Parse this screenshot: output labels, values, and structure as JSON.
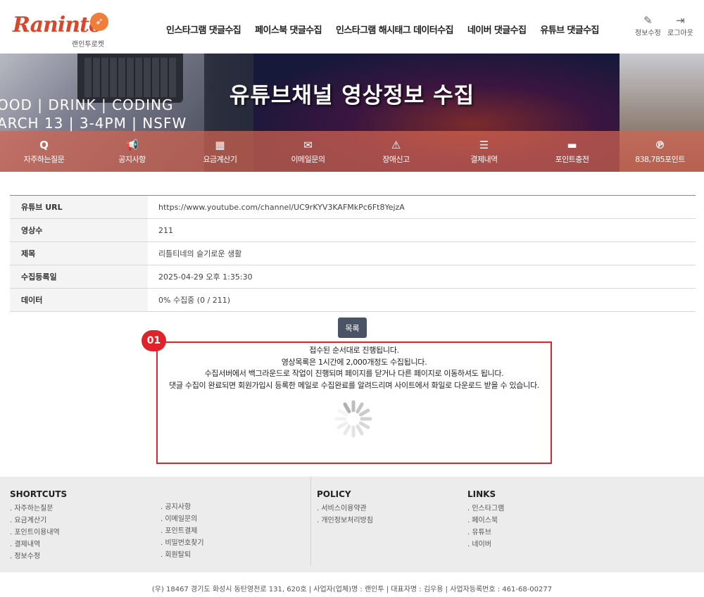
{
  "header": {
    "logo_text": "Raninto",
    "logo_sub": "랜인투로켓",
    "nav": [
      "인스타그램 댓글수집",
      "페이스북 댓글수집",
      "인스타그램 해시태그 데이터수집",
      "네이버 댓글수집",
      "유튜브 댓글수집"
    ],
    "util": [
      {
        "label": "정보수정",
        "icon": "edit-icon"
      },
      {
        "label": "로그아웃",
        "icon": "logout-icon"
      }
    ]
  },
  "banner": {
    "title": "유튜브채널 영상정보 수집",
    "bg_text": "OOD | DRINK | CODING\nARCH 13 | 3-4PM | NSFW",
    "quick": [
      {
        "label": "자주하는질문",
        "icon": "faq-icon",
        "glyph": "Q"
      },
      {
        "label": "공지사항",
        "icon": "megaphone-icon",
        "glyph": "📢"
      },
      {
        "label": "요금계산기",
        "icon": "calculator-icon",
        "glyph": "▦"
      },
      {
        "label": "이메일문의",
        "icon": "mail-icon",
        "glyph": "✉"
      },
      {
        "label": "장애신고",
        "icon": "warning-icon",
        "glyph": "⚠"
      },
      {
        "label": "결제내역",
        "icon": "list-icon",
        "glyph": "☰"
      },
      {
        "label": "포인트충전",
        "icon": "card-icon",
        "glyph": "▬"
      },
      {
        "label": "838,785포인트",
        "icon": "points-icon",
        "glyph": "℗"
      }
    ]
  },
  "info": [
    {
      "label": "유튜브 URL",
      "value": "https://www.youtube.com/channel/UC9rKYV3KAFMkPc6Ft8YejzA"
    },
    {
      "label": "영상수",
      "value": "211"
    },
    {
      "label": "제목",
      "value": "리틀티네의 슬기로운 생활"
    },
    {
      "label": "수집등록일",
      "value": "2025-04-29 오후 1:35:30"
    },
    {
      "label": "데이터",
      "value": "0% 수집중 (0 / 211)"
    }
  ],
  "list_button": "목록",
  "badge": "01",
  "notice": [
    "접수된 순서대로 진행됩니다.",
    "영상목록은 1시간에 2,000개정도 수집됩니다.",
    "수집서버에서 백그라운드로 작업이 진행되며 페이지를 닫거나 다른 페이지로 이동하셔도 됩니다.",
    "댓글 수집이 완료되면 회원가입시 등록한 메일로 수집완료를 알려드리며 사이트에서 화일로 다운로드 받을 수 있습니다."
  ],
  "footer": {
    "shortcuts": {
      "title": "SHORTCUTS",
      "col1": [
        "자주하는질문",
        "요금계산기",
        "포인트이용내역",
        "결제내역",
        "정보수정"
      ],
      "col2": [
        "공지사항",
        "이메일문의",
        "포인트결제",
        "비밀번호찾기",
        "회원탈퇴"
      ]
    },
    "policy": {
      "title": "POLICY",
      "items": [
        "서비스이용약관",
        "개인정보처리방침"
      ]
    },
    "links": {
      "title": "LINKS",
      "items": [
        "인스타그램",
        "페이스북",
        "유튜브",
        "네이버"
      ]
    },
    "copyright": "(우) 18467 경기도 화성시 동탄영천로 131, 620호 | 사업자(업체)명 : 랜인투 | 대표자명 : 김우용 | 사업자등록번호 : 461-68-00277"
  },
  "colors": {
    "accent": "#e1222a",
    "quickbar": "#d26450",
    "button": "#4b5467"
  }
}
